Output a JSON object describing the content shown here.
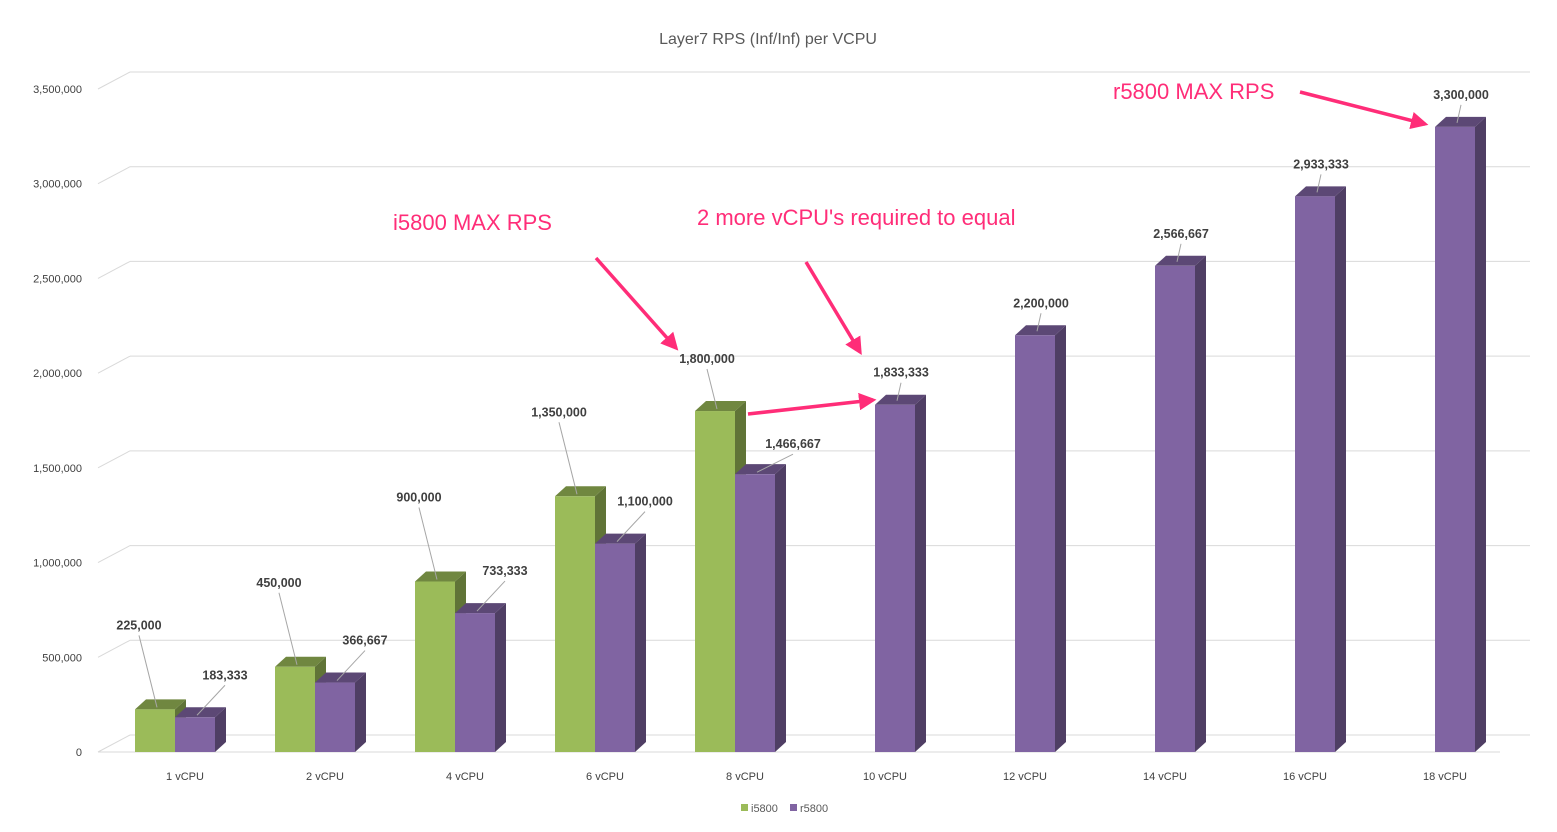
{
  "chart_data": {
    "type": "bar",
    "title": "Layer7 RPS (Inf/Inf) per VCPU",
    "xlabel": "",
    "ylabel": "",
    "categories": [
      "1 vCPU",
      "2 vCPU",
      "4 vCPU",
      "6 vCPU",
      "8 vCPU",
      "10 vCPU",
      "12 vCPU",
      "14 vCPU",
      "16 vCPU",
      "18 vCPU"
    ],
    "series": [
      {
        "name": "i5800",
        "color": "#9bbb59",
        "values": [
          225000,
          450000,
          900000,
          1350000,
          1800000,
          null,
          null,
          null,
          null,
          null
        ],
        "labels": [
          "225,000",
          "450,000",
          "900,000",
          "1,350,000",
          "1,800,000",
          "",
          "",
          "",
          "",
          ""
        ]
      },
      {
        "name": "r5800",
        "color": "#8064a2",
        "values": [
          183333,
          366667,
          733333,
          1100000,
          1466667,
          1833333,
          2200000,
          2566667,
          2933333,
          3300000
        ],
        "labels": [
          "183,333",
          "366,667",
          "733,333",
          "1,100,000",
          "1,466,667",
          "1,833,333",
          "2,200,000",
          "2,566,667",
          "2,933,333",
          "3,300,000"
        ]
      }
    ],
    "ylim": [
      0,
      3500000
    ],
    "yticks": [
      0,
      500000,
      1000000,
      1500000,
      2000000,
      2500000,
      3000000,
      3500000
    ],
    "ytick_labels": [
      "0",
      "500,000",
      "1,000,000",
      "1,500,000",
      "2,000,000",
      "2,500,000",
      "3,000,000",
      "3,500,000"
    ],
    "grid": true,
    "legend_position": "bottom",
    "style": "3d-columns",
    "annotations": [
      {
        "text": "i5800 MAX RPS",
        "color": "#ff2d78"
      },
      {
        "text": "2 more vCPU's required to equal",
        "color": "#ff2d78"
      },
      {
        "text": "r5800 MAX RPS",
        "color": "#ff2d78"
      }
    ]
  }
}
